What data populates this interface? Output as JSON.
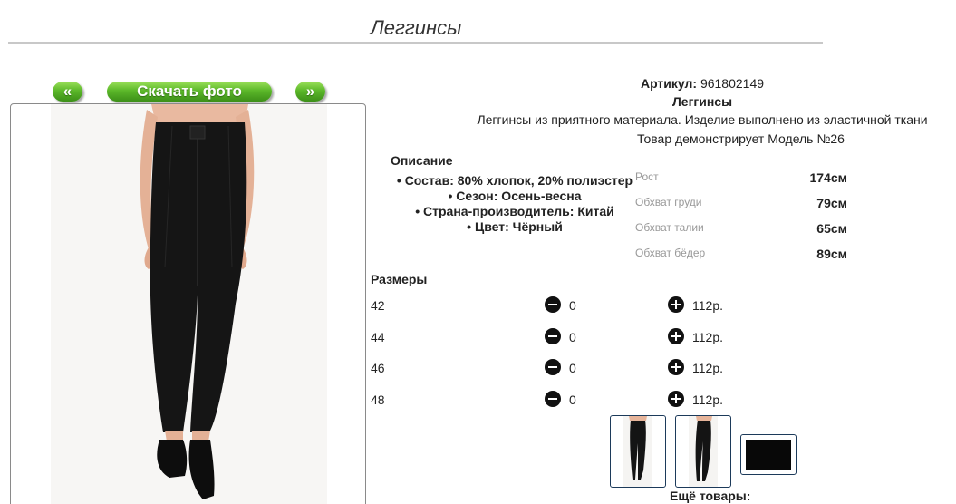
{
  "page": {
    "title": "Леггинсы"
  },
  "nav": {
    "prev_label": "«",
    "next_label": "»",
    "download_label": "Скачать фото"
  },
  "product": {
    "article_label": "Артикул:",
    "article_value": "961802149",
    "name": "Леггинсы",
    "description": "Леггинсы из приятного материала. Изделие выполнено из эластичной ткани",
    "model_note": "Товар демонстрирует Модель №26"
  },
  "details": {
    "heading": "Описание",
    "items": [
      "Состав: 80% хлопок, 20% полиэстер",
      "Сезон: Осень-весна",
      "Страна-производитель: Китай",
      "Цвет: Чёрный"
    ]
  },
  "measurements": [
    {
      "label": "Рост",
      "value": "174см"
    },
    {
      "label": "Обхват груди",
      "value": "79см"
    },
    {
      "label": "Обхват талии",
      "value": "65см"
    },
    {
      "label": "Обхват бёдер",
      "value": "89см"
    }
  ],
  "sizes": {
    "heading": "Размеры",
    "rows": [
      {
        "size": "42",
        "qty": "0",
        "price": "112р."
      },
      {
        "size": "44",
        "qty": "0",
        "price": "112р."
      },
      {
        "size": "46",
        "qty": "0",
        "price": "112р."
      },
      {
        "size": "48",
        "qty": "0",
        "price": "112р."
      }
    ]
  },
  "more": {
    "heading": "Ещё товары:"
  },
  "colors": {
    "accent_green": "#5cb82a",
    "thumb_border": "#1c3a5a",
    "product_black": "#111111"
  }
}
